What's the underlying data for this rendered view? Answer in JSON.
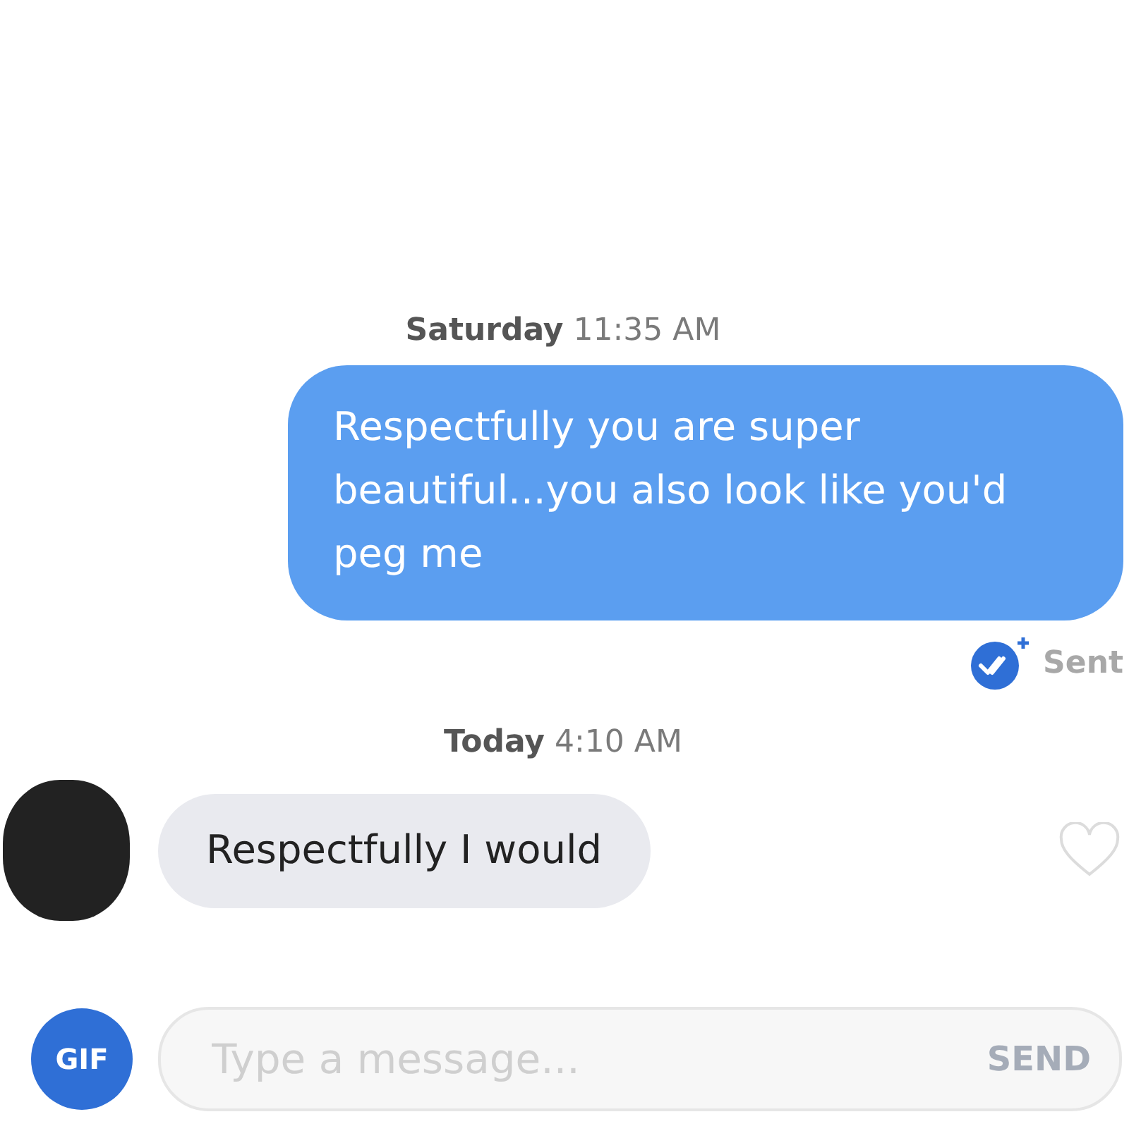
{
  "messages": [
    {
      "kind": "timestamp",
      "text": "**Saturday** 11:35 AM"
    },
    {
      "kind": "outgoing",
      "text": "Respectfully you are super beautiful...you also look like you'd peg me",
      "status": "Sent"
    },
    {
      "kind": "timestamp",
      "text": "**Today** 4:10 AM"
    },
    {
      "kind": "incoming",
      "text": "Respectfully I would",
      "liked": false
    }
  ],
  "composer": {
    "gif": "GIF",
    "placeholder": "Type a message...",
    "send": "SEND"
  }
}
